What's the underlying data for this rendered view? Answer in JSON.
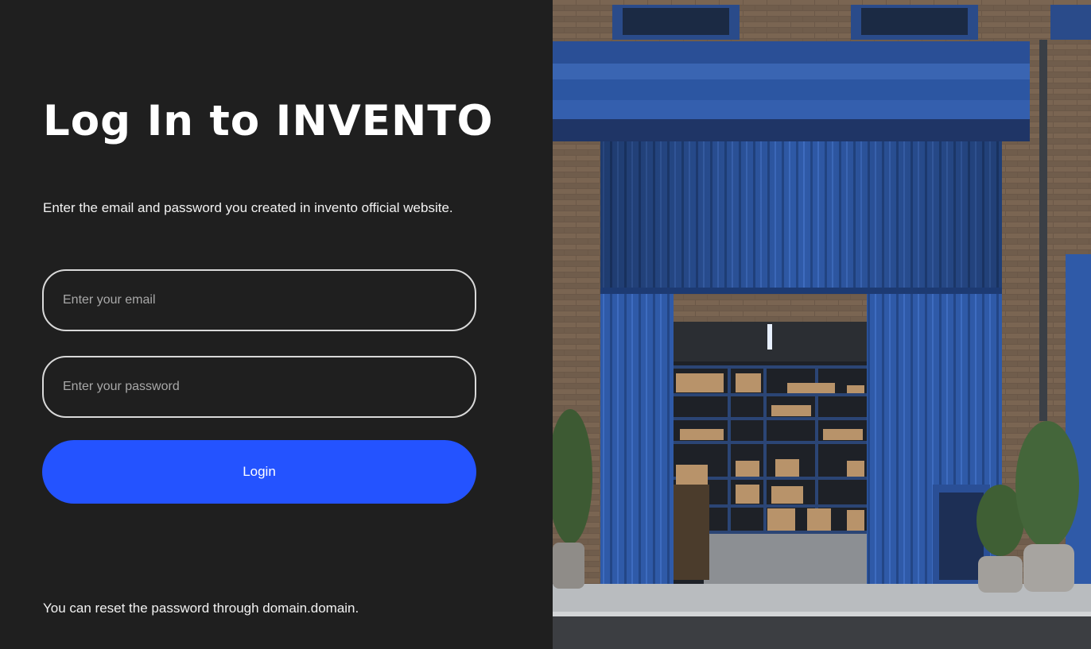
{
  "login": {
    "title": "Log In to INVENTO",
    "subtitle": "Enter the email and password you created in invento official website.",
    "email": {
      "placeholder": "Enter your email",
      "value": ""
    },
    "password": {
      "placeholder": "Enter your password",
      "value": ""
    },
    "login_label": "Login",
    "reset_text": "You can reset the password through domain.domain."
  },
  "colors": {
    "background": "#1f1f1f",
    "accent": "#2453ff",
    "field_border": "#d9d9d9",
    "hero_blue": "#2f5aa8"
  },
  "hero": {
    "subject": "warehouse-storefront-image"
  }
}
